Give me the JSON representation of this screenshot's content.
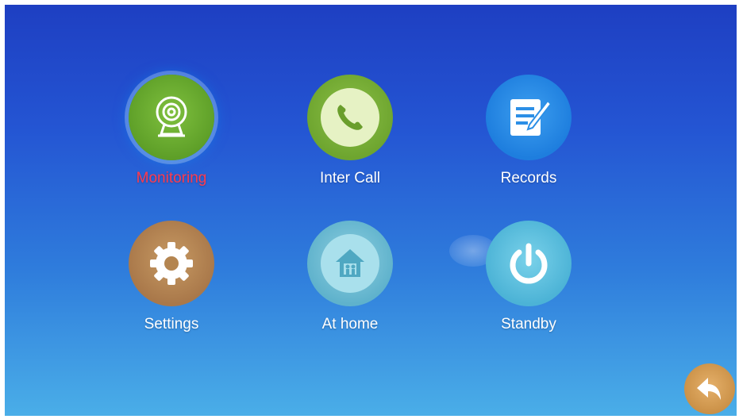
{
  "menu": {
    "items": [
      {
        "label": "Monitoring",
        "icon": "webcam-icon",
        "color": "#6aae2f",
        "selected": true
      },
      {
        "label": "Inter Call",
        "icon": "phone-icon",
        "color": "#7cb33a",
        "selected": false
      },
      {
        "label": "Records",
        "icon": "records-icon",
        "color": "#2c8fe6",
        "selected": false
      },
      {
        "label": "Settings",
        "icon": "gear-icon",
        "color": "#b88954",
        "selected": false
      },
      {
        "label": "At home",
        "icon": "home-icon",
        "color": "#74bfd6",
        "selected": false
      },
      {
        "label": "Standby",
        "icon": "power-icon",
        "color": "#5cc0dd",
        "selected": false
      }
    ]
  },
  "back_button": {
    "icon": "back-arrow-icon",
    "color": "#d9a45c"
  },
  "colors": {
    "selected_label": "#ff3b4e",
    "label": "#ffffff"
  }
}
